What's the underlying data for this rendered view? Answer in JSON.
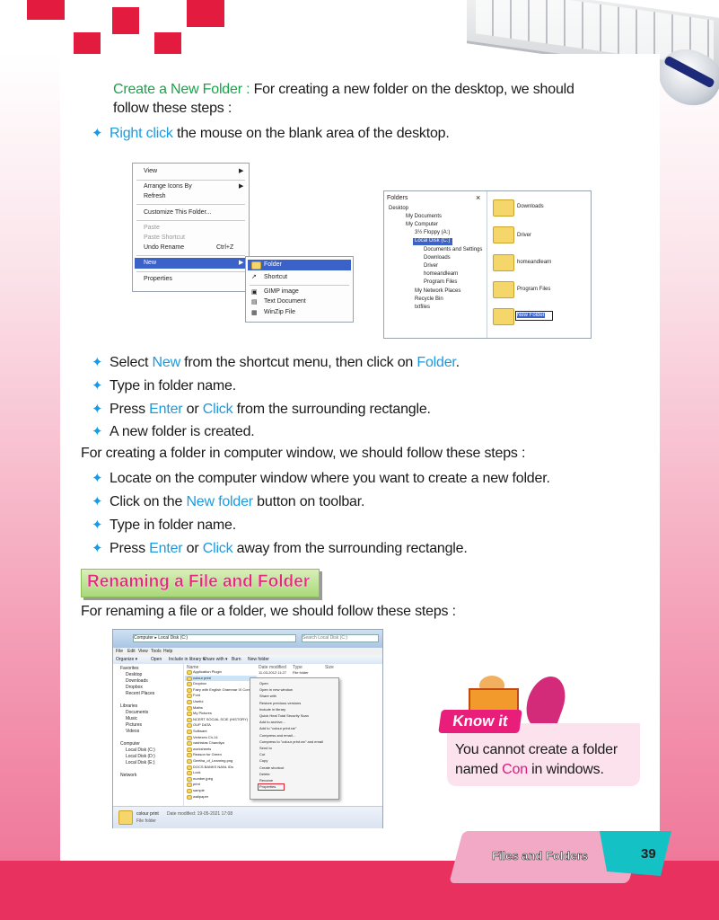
{
  "intro": {
    "heading": "Create a New Folder :",
    "heading_rest": "For creating a new folder on the desktop, we should",
    "heading_line2": "follow these steps :",
    "step1_hl": "Right click",
    "step1_rest": "the mouse on the blank area of the desktop."
  },
  "context_menu": {
    "items": [
      "View",
      "Arrange Icons By",
      "Refresh",
      "Customize This Folder...",
      "Paste",
      "Paste Shortcut",
      "Undo Rename",
      "New",
      "Properties"
    ],
    "undo_shortcut": "Ctrl+Z",
    "submenu": [
      "Folder",
      "Shortcut",
      "GIMP image",
      "Text Document",
      "WinZip File"
    ]
  },
  "explorer": {
    "pane_title": "Folders",
    "close": "×",
    "tree": [
      "Desktop",
      "My Documents",
      "My Computer",
      "3½ Floppy (A:)",
      "Local Disk (C:)",
      "Documents and Settings",
      "Downloads",
      "Driver",
      "homeandlearn",
      "Program Files",
      "My Network Places",
      "Recycle Bin",
      "txtfiles"
    ],
    "folders": [
      "Downloads",
      "Driver",
      "homeandlearn",
      "Program Files"
    ],
    "new_folder_edit": "New Folder"
  },
  "steps1": [
    {
      "pre": "Select ",
      "hl1": "New",
      "mid": " from the shortcut menu, then click on ",
      "hl2": "Folder",
      "post": "."
    },
    {
      "pre": "Type in folder name.",
      "hl1": "",
      "mid": "",
      "hl2": "",
      "post": ""
    },
    {
      "pre": "Press ",
      "hl1": "Enter",
      "mid": " or ",
      "hl2": "Click",
      "post": " from the surrounding rectangle."
    },
    {
      "pre": "A new folder is created.",
      "hl1": "",
      "mid": "",
      "hl2": "",
      "post": ""
    }
  ],
  "computer_intro": "For creating a folder in computer window, we should follow these steps :",
  "steps2": [
    {
      "pre": "Locate on the computer window where you want to create a new folder.",
      "hl1": "",
      "mid": "",
      "hl2": "",
      "post": ""
    },
    {
      "pre": "Click on the ",
      "hl1": "New folder",
      "mid": " button on toolbar.",
      "hl2": "",
      "post": ""
    },
    {
      "pre": "Type in folder name.",
      "hl1": "",
      "mid": "",
      "hl2": "",
      "post": ""
    },
    {
      "pre": "Press ",
      "hl1": "Enter",
      "mid": " or ",
      "hl2": "Click",
      "post": " away from the surrounding rectangle."
    }
  ],
  "section_heading": "Renaming a File and Folder",
  "rename_intro": "For renaming a file or a folder, we should follow these steps :",
  "win7": {
    "address": "Computer ▸ Local Disk (C:)",
    "search": "Search Local Disk (C:)",
    "menubar": [
      "File",
      "Edit",
      "View",
      "Tools",
      "Help"
    ],
    "toolbar": [
      "Organize ▾",
      "Open",
      "Include in library ▾",
      "Share with ▾",
      "Burn",
      "New folder"
    ],
    "columns": [
      "Name",
      "Date modified",
      "Type",
      "Size"
    ],
    "nav": [
      "Favorites",
      "Desktop",
      "Downloads",
      "Dropbox",
      "Recent Places",
      "Libraries",
      "Documents",
      "Music",
      "Pictures",
      "Videos",
      "Computer",
      "Local Disk (C:)",
      "Local Disk (D:)",
      "Local Disk (E:)",
      "Network"
    ],
    "files": [
      "Application Plugin",
      "colour print",
      "Dropbox",
      "Fairy with English Grammar IX Computer",
      "Font",
      "Useful",
      "Maths",
      "My Pictures",
      "NCERT SOCIAL SCIE (HISTORY)",
      "OUP DATA",
      "Software",
      "Vertexes Ch-14",
      "vashistas Chandiya",
      "worksheets",
      "Reason for Green",
      "Geetha_of_Learning.png",
      "DOCS.BANKS NANL IDs",
      "Lock",
      "number.jpeg",
      "print",
      "sample",
      "wallpaper"
    ],
    "date1": "11-03-2012 11:27",
    "type1": "File folder",
    "ctx": [
      "Open",
      "Open in new window",
      "Share with",
      "Restore previous versions",
      "Include in library",
      "Quick Heal Total Security Scan",
      "Add to archive...",
      "Add to \"colour print.rar\"",
      "Compress and email...",
      "Compress to \"colour print.rar\" and email",
      "Send to",
      "Cut",
      "Copy",
      "Create shortcut",
      "Delete",
      "Rename",
      "Properties"
    ],
    "status_name": "colour print",
    "status_detail": "Date modified: 19-05-2021 17:08",
    "status_type": "File folder"
  },
  "know_it": {
    "label": "Know it",
    "text_pre": "You cannot create a folder",
    "text_line2_pre": "named ",
    "text_hl": "Con",
    "text_post": " in windows."
  },
  "footer": {
    "chapter": "Files and Folders",
    "page": "39"
  },
  "colors": {
    "accent_green": "#1aa24a",
    "accent_blue": "#1a9ae0",
    "accent_pink": "#e8277c",
    "brand_red": "#e31b3f"
  }
}
